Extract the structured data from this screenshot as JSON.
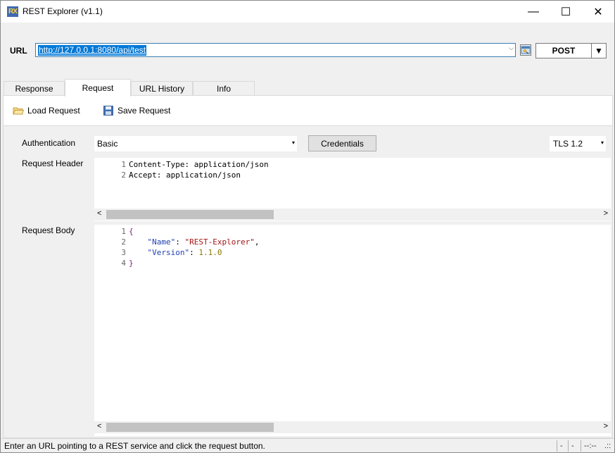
{
  "window": {
    "title": "REST Explorer  (v1.1)",
    "icon_text": "RX",
    "minimize_glyph": "—",
    "maximize_glyph": "☐",
    "close_glyph": "✕"
  },
  "url_bar": {
    "label": "URL",
    "value": "http://127.0.0.1:8080/api/test",
    "dropdown_glyph": "⌵",
    "method_button": "POST",
    "method_dropdown_glyph": "▼"
  },
  "tabs": [
    {
      "label": "Response",
      "active": false
    },
    {
      "label": "Request",
      "active": true
    },
    {
      "label": "URL History",
      "active": false
    },
    {
      "label": "Info",
      "active": false
    }
  ],
  "toolbar": {
    "load_label": "Load Request",
    "save_label": "Save Request"
  },
  "authentication": {
    "label": "Authentication",
    "selected": "Basic",
    "dropdown_glyph": "▾",
    "credentials_button": "Credentials",
    "tls_selected": "TLS 1.2",
    "tls_dropdown_glyph": "▾"
  },
  "request_header": {
    "label": "Request Header",
    "lines": [
      {
        "num": "1",
        "text": "Content-Type: application/json"
      },
      {
        "num": "2",
        "text": "Accept: application/json"
      }
    ]
  },
  "request_body": {
    "label": "Request Body",
    "lines": [
      {
        "num": "1",
        "text": "{"
      },
      {
        "num": "2",
        "key": "\"Name\"",
        "sep": ": ",
        "value": "\"REST-Explorer\"",
        "tail": ","
      },
      {
        "num": "3",
        "key": "\"Version\"",
        "sep": ": ",
        "value": "1.1.0",
        "tail": ""
      },
      {
        "num": "4",
        "text": "}"
      }
    ]
  },
  "scrollbar": {
    "left_glyph": "<",
    "right_glyph": ">"
  },
  "status_bar": {
    "message": "Enter an URL pointing to a REST service and click the request button.",
    "cell1": "-",
    "cell2": "-",
    "cell3": "--:--",
    "grip": ".::"
  },
  "colors": {
    "selection": "#0078d7",
    "url_border": "#3c7fb1",
    "json_key": "#1f3fb5",
    "json_string": "#a31515",
    "json_number": "#8a7a00",
    "json_brace": "#8b1a8b"
  }
}
